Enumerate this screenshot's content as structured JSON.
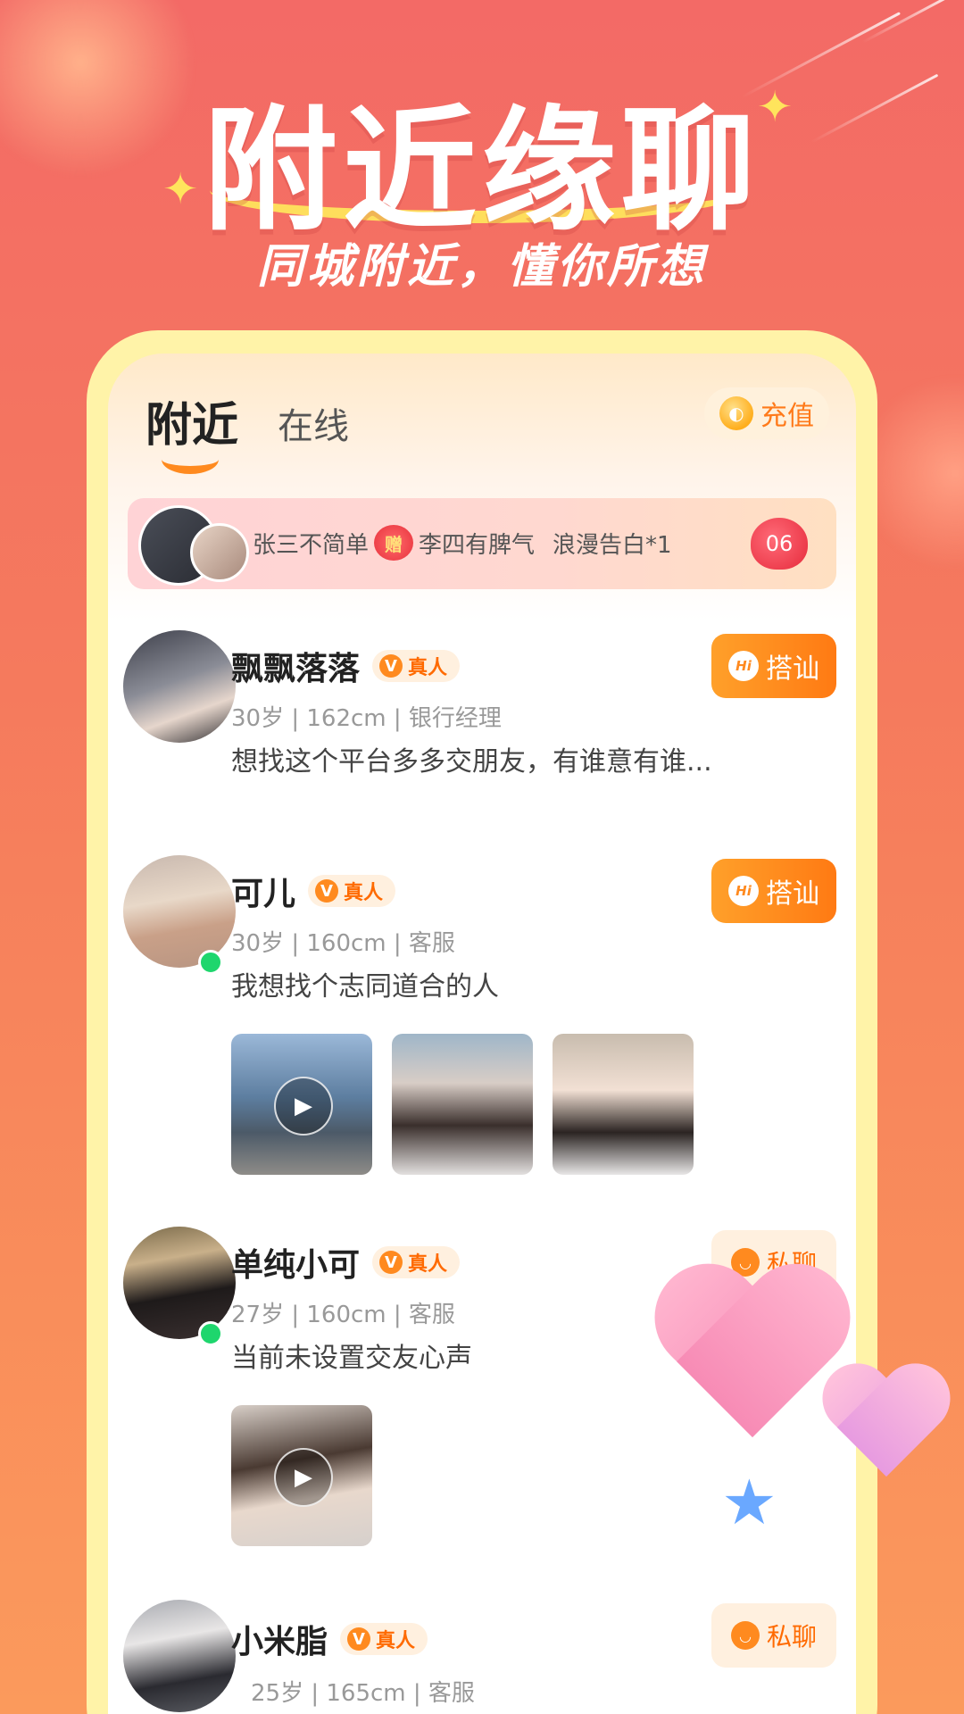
{
  "header": {
    "title": "附近缘聊",
    "subtitle": "同城附近，懂你所想"
  },
  "tabs": [
    {
      "label": "附近",
      "active": true
    },
    {
      "label": "在线",
      "active": false
    }
  ],
  "recharge": {
    "label": "充值",
    "icon": "coin-icon"
  },
  "banner": {
    "sender": "张三不简单",
    "gift_label": "赠",
    "receiver": "李四有脾气",
    "gift_text": "浪漫告白*1",
    "count": "06"
  },
  "users": [
    {
      "name": "飘飘落落",
      "verified_label": "真人",
      "meta": "30岁 | 162cm | 银行经理",
      "bio": "想找这个平台多多交朋友，有谁意有谁...",
      "action": "搭讪",
      "action_type": "hi",
      "online": false,
      "photos": []
    },
    {
      "name": "可儿",
      "verified_label": "真人",
      "meta": "30岁 | 160cm | 客服",
      "bio": "我想找个志同道合的人",
      "action": "搭讪",
      "action_type": "hi",
      "online": true,
      "photos": [
        "video",
        "photo",
        "photo"
      ]
    },
    {
      "name": "单纯小可",
      "verified_label": "真人",
      "meta": "27岁 | 160cm | 客服",
      "bio": "当前未设置交友心声",
      "action": "私聊",
      "action_type": "chat",
      "online": true,
      "photos": [
        "video"
      ]
    },
    {
      "name": "小米脂",
      "verified_label": "真人",
      "meta": "25岁 | 165cm | 客服",
      "bio": "",
      "action": "私聊",
      "action_type": "chat",
      "online": false,
      "photos": []
    }
  ],
  "colors": {
    "accent": "#ff7a13",
    "badge_bg": "#fff0df",
    "online": "#1ed66d",
    "frame": "#fff3a8"
  }
}
